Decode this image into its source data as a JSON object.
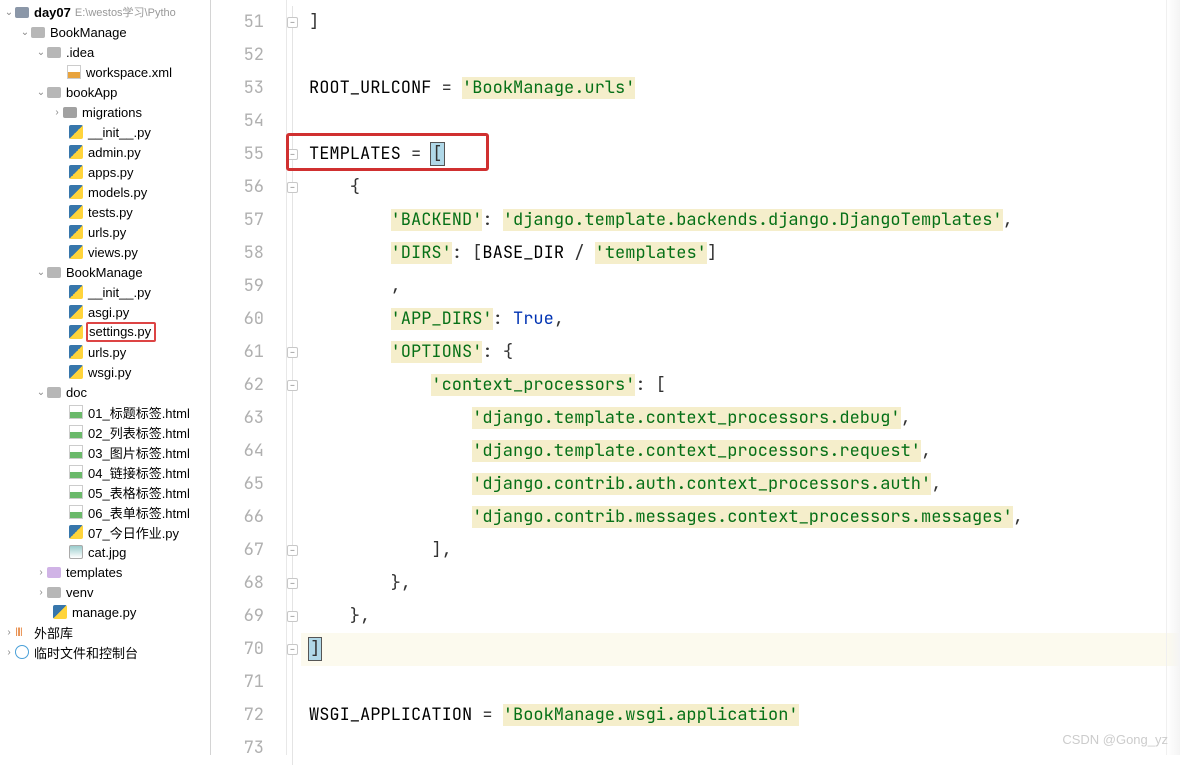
{
  "tree": {
    "root": {
      "name": "day07",
      "path": "E:\\westos学习\\Pytho"
    },
    "bookManage1": "BookManage",
    "idea": ".idea",
    "workspace": "workspace.xml",
    "bookApp": "bookApp",
    "migrations": "migrations",
    "initpy": "__init__.py",
    "adminpy": "admin.py",
    "appspy": "apps.py",
    "modelspy": "models.py",
    "testspy": "tests.py",
    "urlspy1": "urls.py",
    "viewspy": "views.py",
    "bookManage2": "BookManage",
    "initpy2": "__init__.py",
    "asgipy": "asgi.py",
    "settingspy": "settings.py",
    "urlspy2": "urls.py",
    "wsgipy": "wsgi.py",
    "doc": "doc",
    "doc1": "01_标题标签.html",
    "doc2": "02_列表标签.html",
    "doc3": "03_图片标签.html",
    "doc4": "04_链接标签.html",
    "doc5": "05_表格标签.html",
    "doc6": "06_表单标签.html",
    "doc7": "07_今日作业.py",
    "catjpg": "cat.jpg",
    "templates": "templates",
    "venv": "venv",
    "managepy": "manage.py",
    "extlib": "外部库",
    "scratch": "临时文件和控制台"
  },
  "code": {
    "l51": "]",
    "l53a": "ROOT_URLCONF",
    "l53b": " = ",
    "l53c": "'BookManage.urls'",
    "l55a": "TEMPLATES",
    "l55b": " = ",
    "l55c": "[",
    "l56": "    {",
    "l57a": "        ",
    "l57b": "'BACKEND'",
    "l57c": ": ",
    "l57d": "'django.template.backends.django.DjangoTemplates'",
    "l57e": ",",
    "l58a": "        ",
    "l58b": "'DIRS'",
    "l58c": ": [",
    "l58d": "BASE_DIR",
    "l58e": " / ",
    "l58f": "'templates'",
    "l58g": "]",
    "l59": "        ,",
    "l60a": "        ",
    "l60b": "'APP_DIRS'",
    "l60c": ": ",
    "l60d": "True",
    "l60e": ",",
    "l61a": "        ",
    "l61b": "'OPTIONS'",
    "l61c": ": {",
    "l62a": "            ",
    "l62b": "'context_processors'",
    "l62c": ": [",
    "l63a": "                ",
    "l63b": "'django.template.context_processors.debug'",
    "l63c": ",",
    "l64a": "                ",
    "l64b": "'django.template.context_processors.request'",
    "l64c": ",",
    "l65a": "                ",
    "l65b": "'django.contrib.auth.context_processors.auth'",
    "l65c": ",",
    "l66a": "                ",
    "l66b": "'django.contrib.messages.context_processors.messages'",
    "l66c": ",",
    "l67": "            ],",
    "l68": "        },",
    "l69": "    },",
    "l70": "]",
    "l72a": "WSGI_APPLICATION",
    "l72b": " = ",
    "l72c": "'BookManage.wsgi.application'"
  },
  "lineNumbers": [
    "51",
    "52",
    "53",
    "54",
    "55",
    "56",
    "57",
    "58",
    "59",
    "60",
    "61",
    "62",
    "63",
    "64",
    "65",
    "66",
    "67",
    "68",
    "69",
    "70",
    "71",
    "72",
    "73"
  ],
  "watermark": "CSDN @Gong_yz"
}
